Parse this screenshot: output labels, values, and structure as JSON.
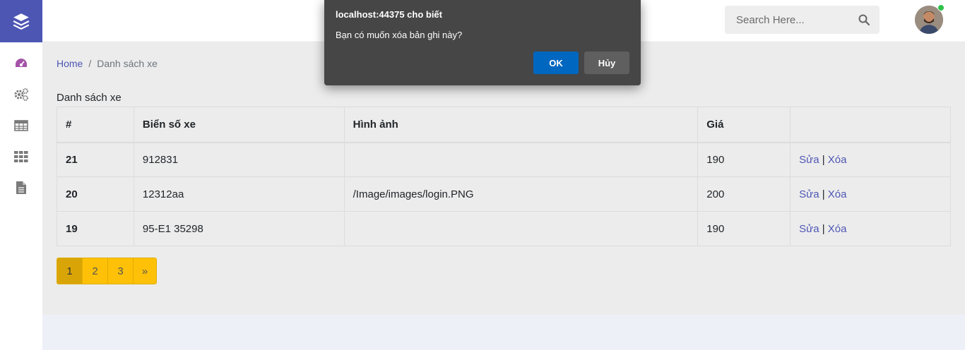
{
  "sidebar": {
    "logo_icon": "layers-icon",
    "items": [
      {
        "icon": "dashboard-gauge-icon",
        "color": "#a454a8"
      },
      {
        "icon": "gears-icon",
        "color": "#7a7a7a"
      },
      {
        "icon": "table-icon",
        "color": "#7a7a7a"
      },
      {
        "icon": "grid-icon",
        "color": "#7a7a7a"
      },
      {
        "icon": "document-icon",
        "color": "#7a7a7a"
      }
    ]
  },
  "header": {
    "search_placeholder": "Search Here...",
    "search_icon": "search-icon"
  },
  "breadcrumb": {
    "home": "Home",
    "separator": "/",
    "current": "Danh sách xe"
  },
  "section_title": "Danh sách xe",
  "table": {
    "headers": [
      "#",
      "Biển số xe",
      "Hình ảnh",
      "Giá",
      ""
    ],
    "rows": [
      {
        "id": "21",
        "plate": "912831",
        "image": "",
        "price": "190",
        "edit": "Sửa",
        "sep": "|",
        "delete": "Xóa"
      },
      {
        "id": "20",
        "plate": "12312aa",
        "image": "/Image/images/login.PNG",
        "price": "200",
        "edit": "Sửa",
        "sep": "|",
        "delete": "Xóa"
      },
      {
        "id": "19",
        "plate": "95-E1 35298",
        "image": "",
        "price": "190",
        "edit": "Sửa",
        "sep": "|",
        "delete": "Xóa"
      }
    ]
  },
  "pagination": {
    "pages": [
      "1",
      "2",
      "3",
      "»"
    ],
    "active": "1"
  },
  "dialog": {
    "title": "localhost:44375 cho biết",
    "message": "Bạn có muốn xóa bản ghi này?",
    "ok": "OK",
    "cancel": "Hủy"
  },
  "colors": {
    "brand": "#4e56b4",
    "dialog_bg": "#464646",
    "ok_button": "#0067c0",
    "page_button": "#ffc107",
    "online": "#2ec24a"
  }
}
